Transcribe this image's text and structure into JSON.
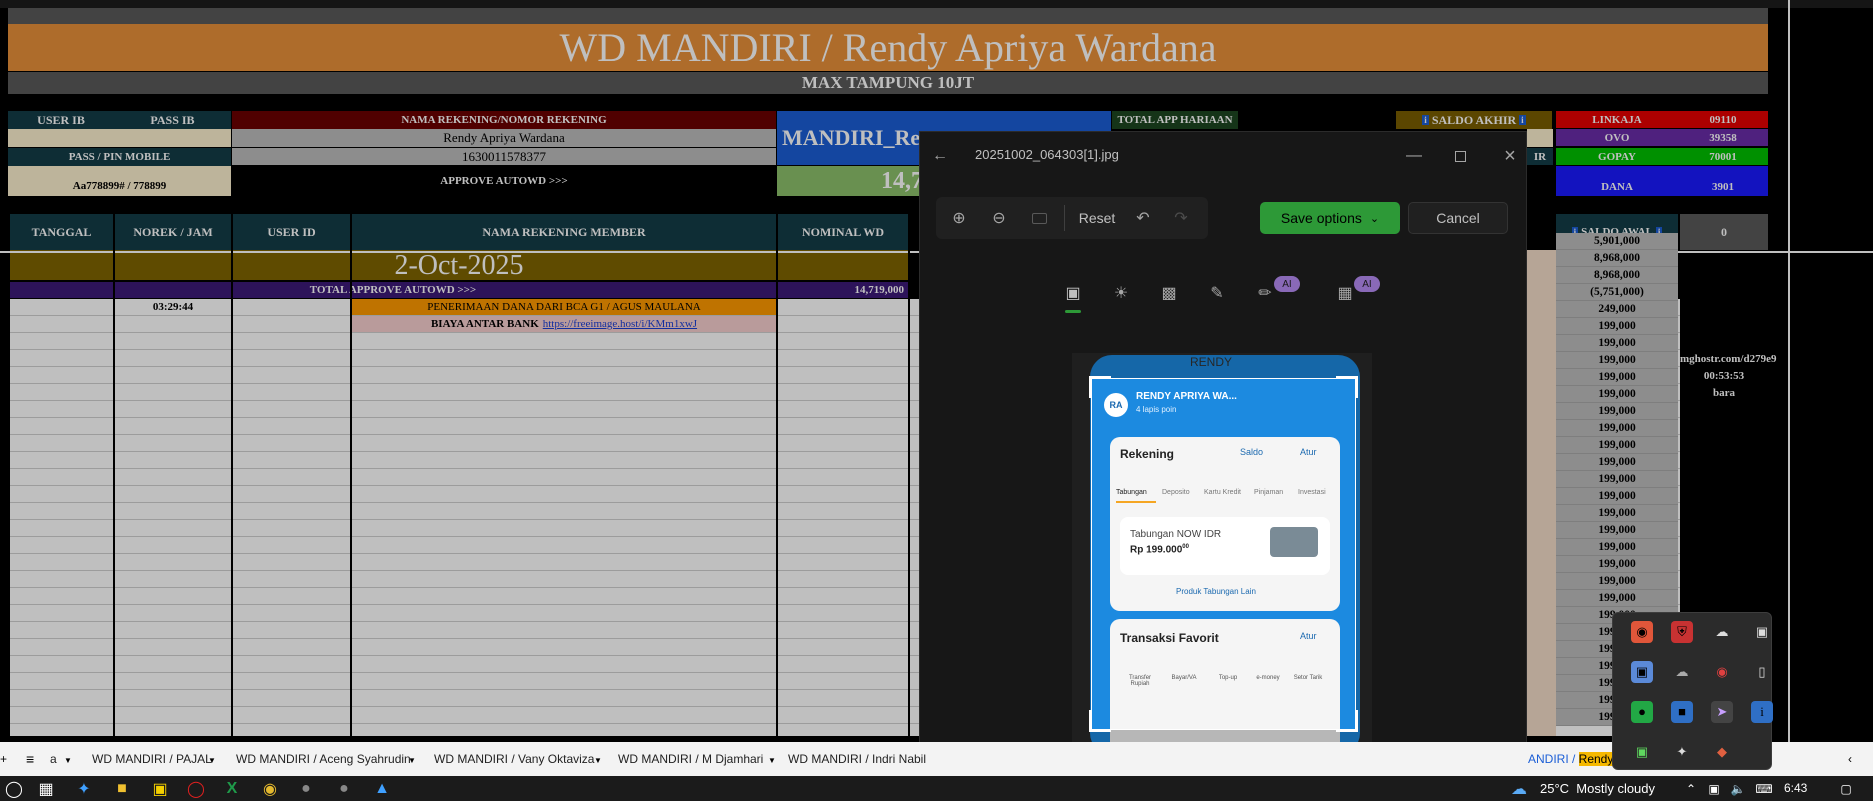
{
  "sheet": {
    "title": "WD MANDIRI / Rendy Apriya Wardana",
    "subtitle": "MAX TAMPUNG 10JT",
    "user_ib_label": "USER IB",
    "pass_ib_label": "PASS IB",
    "pass_pin_label": "PASS / PIN MOBILE",
    "pin_value": "Aa778899# / 778899",
    "nama_rek_label": "NAMA REKENING/NOMOR REKENING",
    "nama_rek_value": "Rendy Apriya Wardana",
    "nomor_rek_value": "1630011578377",
    "approve_autowd": "APPROVE AUTOWD >>>",
    "mandiri_label": "MANDIRI_Ren",
    "total_app_label": "TOTAL APP HARIAAN",
    "big_value": "14,7",
    "saldo_akhir_label": "SALDO AKHIR",
    "saldo_akhir_partial": "IR",
    "ewallets": [
      {
        "name": "LINKAJA",
        "value": "09110",
        "color": "#e60000"
      },
      {
        "name": "OVO",
        "value": "39358",
        "color": "#6a2ca8"
      },
      {
        "name": "GOPAY",
        "value": "70001",
        "color": "#00c000"
      },
      {
        "name": "DANA",
        "value": "3901",
        "color": "#1a1aff"
      }
    ],
    "columns": [
      "TANGGAL",
      "NOREK / JAM",
      "USER ID",
      "NAMA REKENING MEMBER",
      "NOMINAL WD"
    ],
    "saldo_awal_label": "SALDO AWAL",
    "zero_value": "0",
    "date_banner": "2-Oct-2025",
    "total_approve_label": "TOTAL APPROVE AUTOWD >>>",
    "total_approve_value": "14,719,000",
    "row1_time": "03:29:44",
    "row1_desc": "PENERIMAAN DANA DARI BCA G1 / AGUS MAULANA",
    "row2_desc": "BIAYA ANTAR BANK",
    "row2_link": "https://freeimage.host/i/KMm1xwJ",
    "saldo_values": [
      "5,901,000",
      "8,968,000",
      "8,968,000",
      "(5,751,000)",
      "249,000",
      "199,000",
      "199,000",
      "199,000",
      "199,000",
      "199,000",
      "199,000",
      "199,000",
      "199,000",
      "199,000",
      "199,000",
      "199,000",
      "199,000",
      "199,000",
      "199,000",
      "199,000",
      "199,000",
      "199,000",
      "199,000",
      "199,000",
      "199,000",
      "199,000",
      "199,000",
      "199,000",
      "199,000",
      "199,000"
    ],
    "side_link": "mghostr.com/d279e9",
    "side_time": "00:53:53",
    "side_word": "bara"
  },
  "photos": {
    "filename": "20251002_064303[1].jpg",
    "reset_label": "Reset",
    "save_label": "Save options",
    "cancel_label": "Cancel",
    "ai_badge": "AI",
    "phone": {
      "header_name": "RENDY APRIYA WA...",
      "header_sub": "4 lapis poin",
      "avatar": "RA",
      "top_label": "RENDY",
      "rekening": "Rekening",
      "saldo": "Saldo",
      "atur": "Atur",
      "tabs": [
        "Tabungan",
        "Deposito",
        "Kartu Kredit",
        "Pinjaman",
        "Investasi"
      ],
      "tab_name": "Tabungan NOW IDR",
      "tab_amount": "Rp 199.000",
      "tab_cents": "00",
      "produk_link": "Produk Tabungan Lain",
      "transaksi": "Transaksi Favorit",
      "fav_items": [
        "Transfer Rupiah",
        "Bayar/VA",
        "Top-up",
        "e-money",
        "Setor Tarik"
      ]
    }
  },
  "tabs": {
    "items": [
      "a",
      "WD MANDIRI / PAJAL",
      "WD MANDIRI / Aceng Syahrudin",
      "WD MANDIRI / Vany Oktaviza",
      "WD MANDIRI / M Djamhari",
      "WD MANDIRI / Indri Nabil"
    ],
    "right_partial_a": "ANDIRI / ",
    "right_partial_b": "Rendy A"
  },
  "taskbar": {
    "weather": "25°C  Mostly cloudy",
    "time": "6:43"
  }
}
